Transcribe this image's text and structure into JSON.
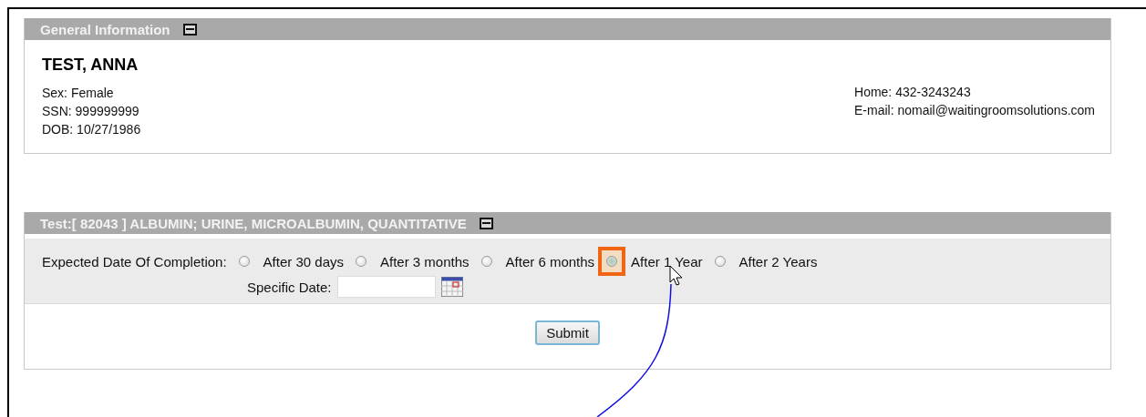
{
  "general_information": {
    "title": "General Information",
    "patient_name": "TEST, ANNA",
    "details_left": [
      "Sex: Female",
      "SSN: 999999999",
      "DOB: 10/27/1986"
    ],
    "details_right": [
      "Home: 432-3243243",
      "E-mail: nomail@waitingroomsolutions.com"
    ]
  },
  "test": {
    "title": "Test:[ 82043 ] ALBUMIN; URINE, MICROALBUMIN, QUANTITATIVE",
    "completion_label": "Expected Date Of Completion:",
    "options": [
      {
        "label": "After 30 days",
        "selected": false,
        "highlighted": false
      },
      {
        "label": "After 3 months",
        "selected": false,
        "highlighted": false
      },
      {
        "label": "After 6 months",
        "selected": false,
        "highlighted": false
      },
      {
        "label": "After 1 Year",
        "selected": false,
        "highlighted": true
      },
      {
        "label": "After 2 Years",
        "selected": false,
        "highlighted": false
      }
    ],
    "specific_date_label": "Specific Date:",
    "submit": "Submit"
  }
}
